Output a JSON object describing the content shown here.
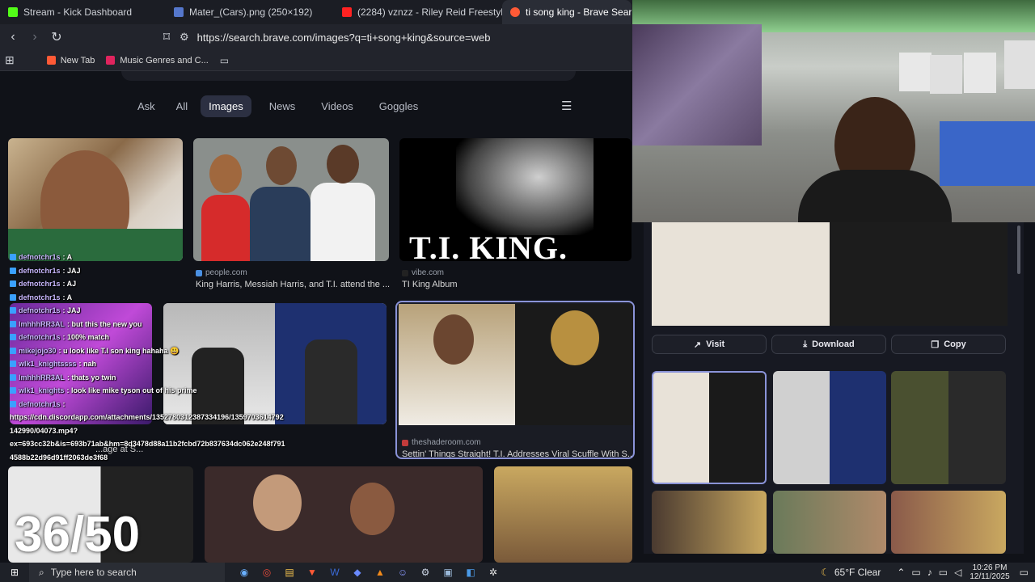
{
  "tabs": [
    {
      "label": "Stream - Kick Dashboard",
      "color": "#53fc18"
    },
    {
      "label": "Mater_(Cars).png (250×192)",
      "color": "#5577cc"
    },
    {
      "label": "(2284) vznzz - Riley Reid Freestyle - Y",
      "color": "#ff2222"
    },
    {
      "label": "ti song king - Brave Search",
      "color": "#ff5a36"
    }
  ],
  "url": "https://search.brave.com/images?q=ti+song+king&source=web",
  "bookmarks": [
    {
      "label": "New Tab"
    },
    {
      "label": "Music Genres and C..."
    }
  ],
  "search_tabs": [
    "Ask",
    "All",
    "Images",
    "News",
    "Videos",
    "Goggles"
  ],
  "results": [
    {
      "source": "people.com",
      "title": "King Harris, Messiah Harris, and T.I. attend the ..."
    },
    {
      "source": "vibe.com",
      "title": "TI King Album"
    },
    {
      "source": "theshaderoom.com",
      "title": "Settin' Things Straight! T.I. Addresses Viral Scuffle With S..."
    },
    {
      "title": "...age at S..."
    }
  ],
  "album_text": "T.I. KING.",
  "chat": [
    {
      "name": "defnotchr1s",
      "msg": ": A"
    },
    {
      "name": "defnotchr1s",
      "msg": ": JAJ"
    },
    {
      "name": "defnotchr1s",
      "msg": ": AJ"
    },
    {
      "name": "defnotchr1s",
      "msg": ": A"
    },
    {
      "name": "defnotchr1s",
      "msg": ": JAJ"
    },
    {
      "name": "lmhhhRR3AL",
      "msg": ": but this the new you"
    },
    {
      "name": "defnotchr1s",
      "msg": ": 100% match"
    },
    {
      "name": "mikejojo30",
      "msg": ": u look like T.I son king hahaha 😃"
    },
    {
      "name": "wlk1_knightssss",
      "msg": ": nah"
    },
    {
      "name": "lmhhhRR3AL",
      "msg": ": thats yo twin"
    },
    {
      "name": "wlk1_knights",
      "msg": ": look like mike tyson out of his prime"
    },
    {
      "name": "defnotchr1s",
      "msg": ":"
    }
  ],
  "chat_link": [
    "https://cdn.discordapp.com/attachments/1352780312387334196/1359703614792",
    "142990/04073.mp4?",
    "ex=693cc32b&is=693b71ab&hm=8d3478d88a11b2fcbd72b837634dc062e248f791",
    "4588b22d96d91ff2063de3f68"
  ],
  "counter": "36/50",
  "panel_buttons": {
    "visit": "Visit",
    "download": "Download",
    "copy": "Copy"
  },
  "taskbar": {
    "search_placeholder": "Type here to search",
    "weather": "65°F Clear",
    "time": "10:26 PM",
    "date": "12/11/2025"
  }
}
